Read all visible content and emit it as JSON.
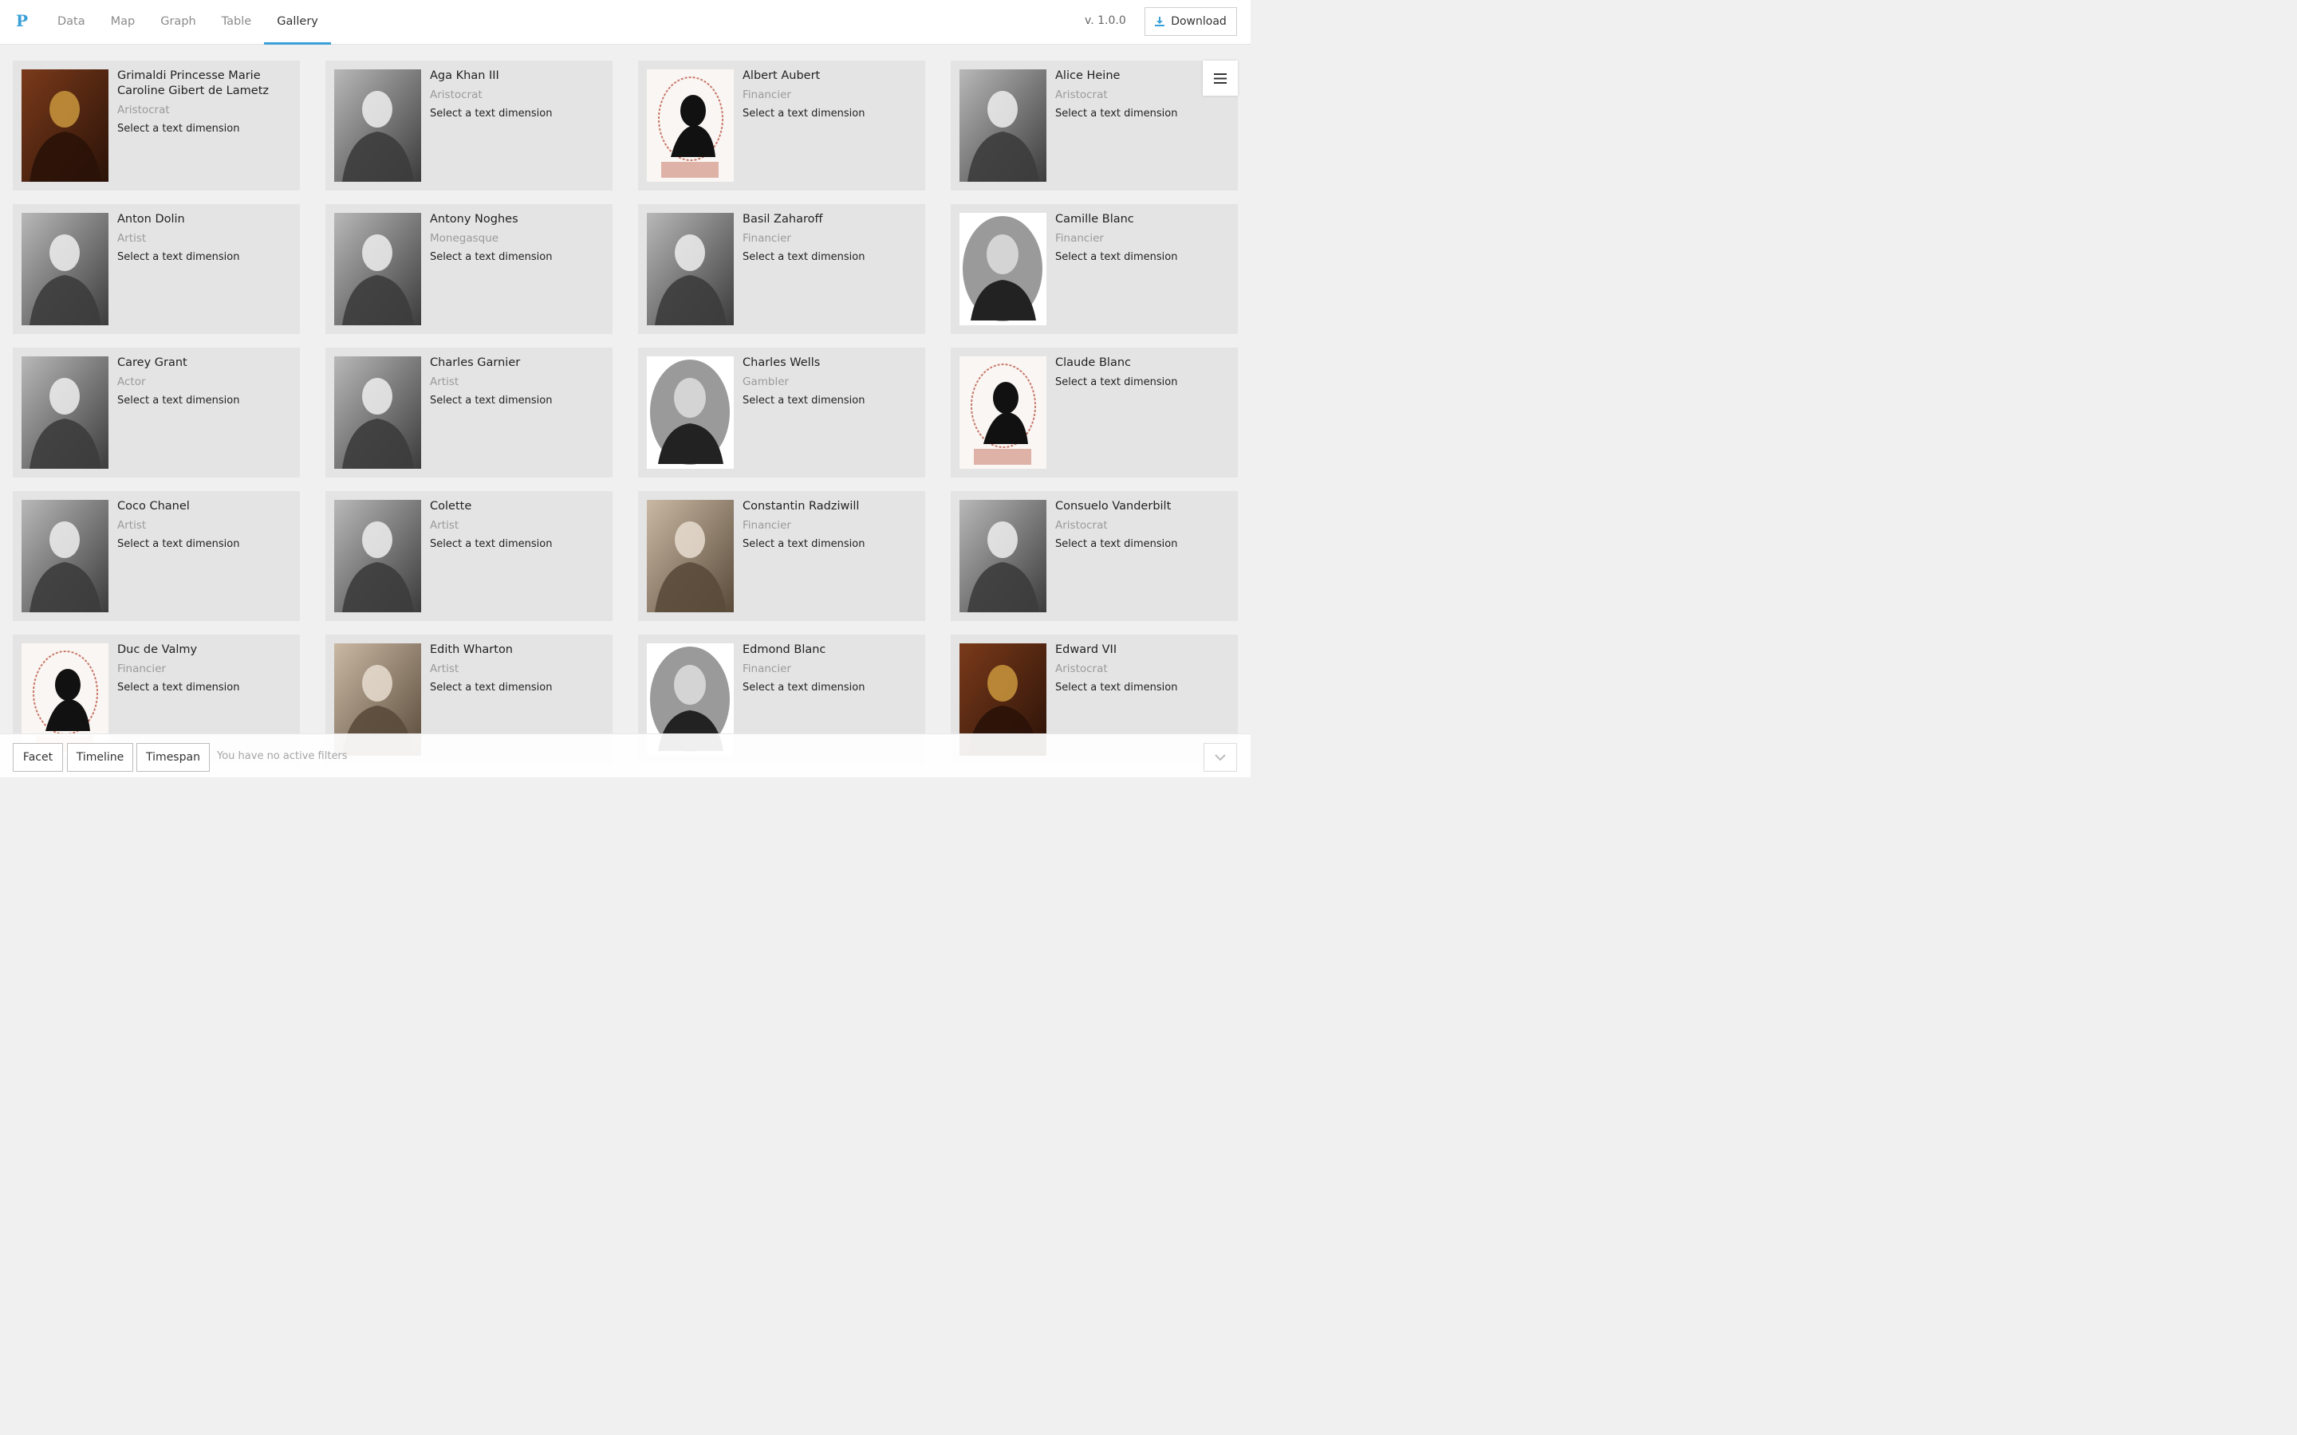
{
  "app": {
    "logo": "P",
    "version": "v. 1.0.0"
  },
  "nav": {
    "tabs": [
      {
        "label": "Data"
      },
      {
        "label": "Map"
      },
      {
        "label": "Graph"
      },
      {
        "label": "Table"
      },
      {
        "label": "Gallery",
        "active": true
      }
    ],
    "download_label": "Download",
    "download_icon": "download-icon",
    "menu_icon": "hamburger-menu-icon"
  },
  "gallery": {
    "placeholder_dimension": "Select a text dimension",
    "items": [
      {
        "name": "Grimaldi Princesse Marie Caroline Gibert de Lametz",
        "category": "Aristocrat",
        "photo": "painting"
      },
      {
        "name": "Aga Khan III",
        "category": "Aristocrat",
        "photo": "bw"
      },
      {
        "name": "Albert Aubert",
        "category": "Financier",
        "photo": "silhouette"
      },
      {
        "name": "Alice Heine",
        "category": "Aristocrat",
        "photo": "bw"
      },
      {
        "name": "Anton Dolin",
        "category": "Artist",
        "photo": "bw"
      },
      {
        "name": "Antony Noghes",
        "category": "Monegasque",
        "photo": "bw"
      },
      {
        "name": "Basil Zaharoff",
        "category": "Financier",
        "photo": "bw"
      },
      {
        "name": "Camille Blanc",
        "category": "Financier",
        "photo": "oval"
      },
      {
        "name": "Carey Grant",
        "category": "Actor",
        "photo": "bw"
      },
      {
        "name": "Charles Garnier",
        "category": "Artist",
        "photo": "bw"
      },
      {
        "name": "Charles Wells",
        "category": "Gambler",
        "photo": "oval"
      },
      {
        "name": "Claude Blanc",
        "category": "",
        "photo": "silhouette"
      },
      {
        "name": "Coco Chanel",
        "category": "Artist",
        "photo": "bw"
      },
      {
        "name": "Colette",
        "category": "Artist",
        "photo": "bw"
      },
      {
        "name": "Constantin Radziwill",
        "category": "Financier",
        "photo": "sepia"
      },
      {
        "name": "Consuelo Vanderbilt",
        "category": "Aristocrat",
        "photo": "bw"
      },
      {
        "name": "Duc de Valmy",
        "category": "Financier",
        "photo": "silhouette"
      },
      {
        "name": "Edith Wharton",
        "category": "Artist",
        "photo": "sepia"
      },
      {
        "name": "Edmond Blanc",
        "category": "Financier",
        "photo": "oval"
      },
      {
        "name": "Edward VII",
        "category": "Aristocrat",
        "photo": "painting"
      }
    ]
  },
  "footer": {
    "buttons": [
      {
        "label": "Facet"
      },
      {
        "label": "Timeline"
      },
      {
        "label": "Timespan"
      }
    ],
    "status": "You have no active filters",
    "collapse_icon": "chevron-down-icon"
  },
  "colors": {
    "accent": "#3aa0d8",
    "card_bg": "#e4e4e4",
    "page_bg": "#f0f0f0"
  }
}
